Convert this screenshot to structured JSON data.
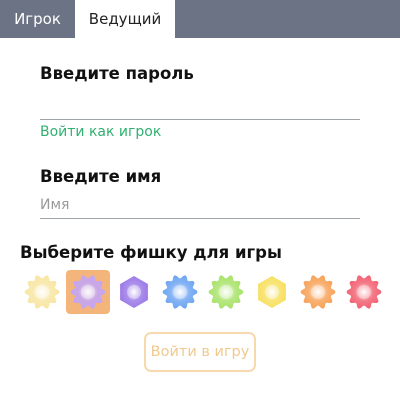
{
  "tabs": {
    "player": "Игрок",
    "host": "Ведущий"
  },
  "password": {
    "label": "Введите пароль",
    "value": "",
    "placeholder": ""
  },
  "login_as_player": "Войти как игрок",
  "name": {
    "label": "Введите имя",
    "value": "",
    "placeholder": "Имя"
  },
  "token_heading": "Выберите фишку для игры",
  "tokens": [
    {
      "name": "sun-token-icon",
      "color": "#f7e6a3",
      "selected": false
    },
    {
      "name": "lilac-token-icon",
      "color": "#c3a5f6",
      "selected": true
    },
    {
      "name": "purple-gem-token-icon",
      "color": "#9d7be8",
      "selected": false
    },
    {
      "name": "blue-gem-token-icon",
      "color": "#6fa6f2",
      "selected": false
    },
    {
      "name": "green-token-icon",
      "color": "#a9e36b",
      "selected": false
    },
    {
      "name": "yellow-gem-token-icon",
      "color": "#f7e063",
      "selected": false
    },
    {
      "name": "orange-token-icon",
      "color": "#f8a35a",
      "selected": false
    },
    {
      "name": "red-token-icon",
      "color": "#f26373",
      "selected": false
    }
  ],
  "enter_button": "Войти в игру",
  "colors": {
    "tabbar": "#6b7384",
    "link": "#2fb170",
    "selection": "#f3b57c",
    "button_border": "#f6d9ad",
    "button_text": "#f1c98f"
  }
}
